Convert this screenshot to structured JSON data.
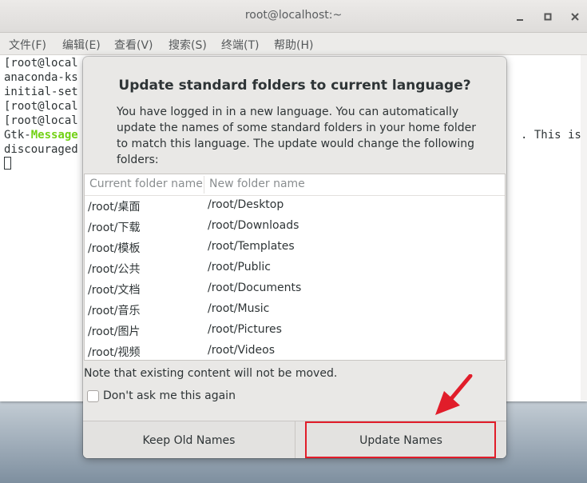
{
  "window": {
    "title": "root@localhost:~"
  },
  "menu": [
    "文件(F)",
    "编辑(E)",
    "查看(V)",
    "搜索(S)",
    "终端(T)",
    "帮助(H)"
  ],
  "terminal": {
    "lines": [
      "[root@local",
      "anaconda-ks",
      "initial-set",
      "[root@local",
      "[root@local"
    ],
    "gtk_prefix": "Gtk-",
    "gtk_message": "Message",
    "overflow_right": ". This is",
    "last_line": "discouraged"
  },
  "dialog": {
    "title": "Update standard folders to current language?",
    "message": "You have logged in in a new language. You can automatically update the names of some standard folders in your home folder to match this language. The update would change the following folders:",
    "columns": [
      "Current folder name",
      "New folder name"
    ],
    "rows": [
      [
        "/root/桌面",
        "/root/Desktop"
      ],
      [
        "/root/下载",
        "/root/Downloads"
      ],
      [
        "/root/模板",
        "/root/Templates"
      ],
      [
        "/root/公共",
        "/root/Public"
      ],
      [
        "/root/文档",
        "/root/Documents"
      ],
      [
        "/root/音乐",
        "/root/Music"
      ],
      [
        "/root/图片",
        "/root/Pictures"
      ],
      [
        "/root/视频",
        "/root/Videos"
      ]
    ],
    "note": "Note that existing content will not be moved.",
    "checkbox_label": "Don't ask me this again",
    "checkbox_checked": false,
    "keep_button": "Keep Old Names",
    "update_button": "Update Names"
  },
  "colors": {
    "highlight": "#e11d2a",
    "terminal_green": "#73d216"
  }
}
